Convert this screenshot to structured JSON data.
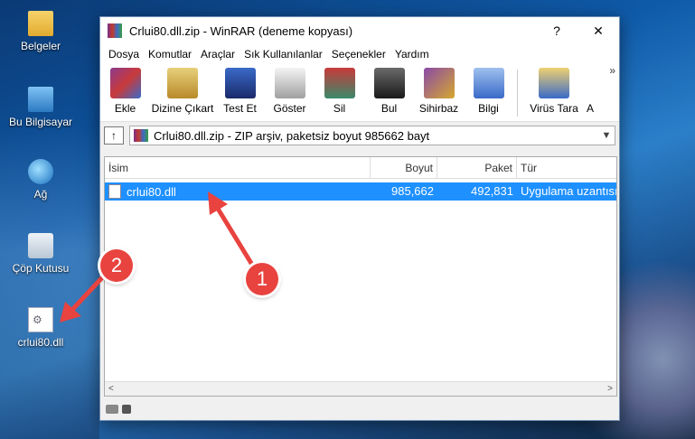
{
  "desktop": {
    "icons": [
      {
        "label": "Belgeler",
        "icon": "folder-icon"
      },
      {
        "label": "Bu Bilgisayar",
        "icon": "computer-icon"
      },
      {
        "label": "Ağ",
        "icon": "network-icon"
      },
      {
        "label": "Çöp Kutusu",
        "icon": "recycle-bin-icon"
      },
      {
        "label": "crlui80.dll",
        "icon": "dll-file-icon"
      }
    ]
  },
  "window": {
    "title": "Crlui80.dll.zip - WinRAR (deneme kopyası)",
    "help_btn": "?",
    "close_btn": "✕",
    "menu": [
      "Dosya",
      "Komutlar",
      "Araçlar",
      "Sık Kullanılanlar",
      "Seçenekler",
      "Yardım"
    ],
    "toolbar": [
      {
        "label": "Ekle",
        "icon": "add-icon",
        "color": "#8b3a8f"
      },
      {
        "label": "Dizine Çıkart",
        "icon": "extract-icon",
        "color": "#c9a03a"
      },
      {
        "label": "Test Et",
        "icon": "test-icon",
        "color": "#2a5cb8"
      },
      {
        "label": "Göster",
        "icon": "view-icon",
        "color": "#9a9a9a"
      },
      {
        "label": "Sil",
        "icon": "delete-icon",
        "color": "#3a8a6a"
      },
      {
        "label": "Bul",
        "icon": "find-icon",
        "color": "#3a3a3a"
      },
      {
        "label": "Sihirbaz",
        "icon": "wizard-icon",
        "color": "#8a4aa8"
      },
      {
        "label": "Bilgi",
        "icon": "info-icon",
        "color": "#3a6ac8"
      },
      {
        "label": "Virüs Tara",
        "icon": "virus-scan-icon",
        "color": "#d6a82e"
      },
      {
        "label": "A",
        "icon": "more-icon",
        "color": "#ffffff"
      }
    ],
    "more": "»",
    "up_btn": "↑",
    "path": "Crlui80.dll.zip - ZIP arşiv, paketsiz boyut 985662 bayt",
    "columns": {
      "name": "İsim",
      "size": "Boyut",
      "packed": "Paket",
      "type": "Tür"
    },
    "files": [
      {
        "name": "crlui80.dll",
        "size": "985,662",
        "packed": "492,831",
        "type": "Uygulama uzantısı"
      }
    ],
    "scroll_left": "<",
    "scroll_right": ">"
  },
  "annotations": {
    "one": "1",
    "two": "2"
  }
}
